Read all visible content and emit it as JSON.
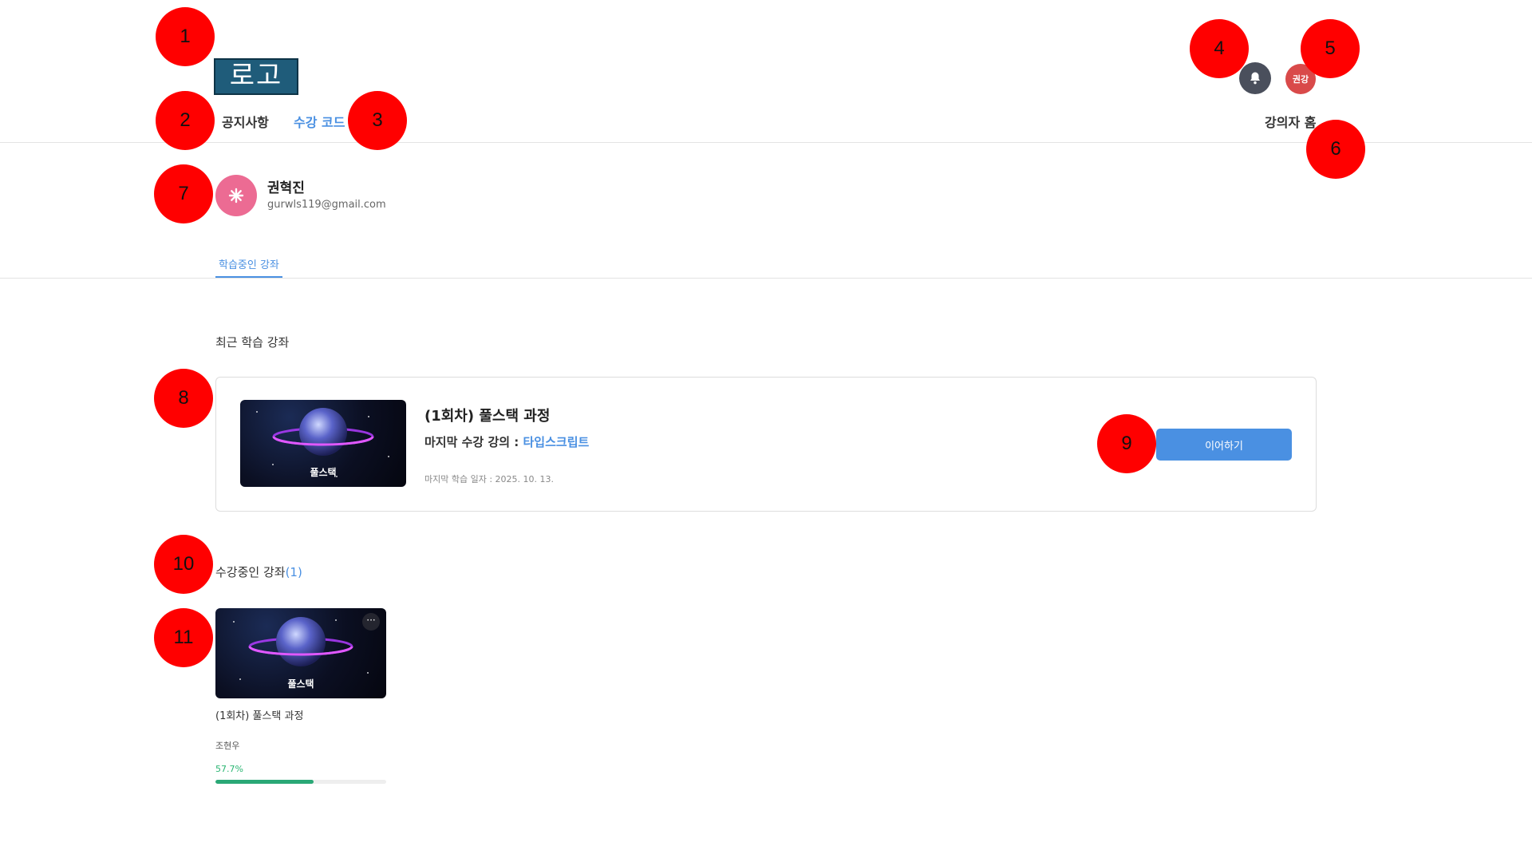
{
  "header": {
    "logo_text": "로고",
    "nav": [
      {
        "label": "공지사항",
        "active": false
      },
      {
        "label": "수강 코드",
        "active": true
      }
    ],
    "bell_icon": "bell-icon",
    "user_avatar_text": "권강",
    "lecturer_home_label": "강의자 홈"
  },
  "profile": {
    "avatar_icon": "asterisk-icon",
    "name": "권혁진",
    "email": "gurwls119@gmail.com"
  },
  "tabs": [
    {
      "label": "학습중인 강좌",
      "active": true
    }
  ],
  "recent": {
    "section_title": "최근 학습 강좌",
    "course_title": "(1회차) 풀스택 과정",
    "thumbnail_label": "풀스택",
    "last_lecture_prefix": "마지막 수강 강의 : ",
    "last_lecture_name": "타입스크립트",
    "last_date": "마지막 학습 일자 : 2025. 10. 13.",
    "continue_label": "이어하기"
  },
  "enrolled": {
    "section_title": "수강중인 강좌",
    "count": "(1)",
    "courses": [
      {
        "thumbnail_label": "풀스택",
        "title": "(1회차) 풀스택 과정",
        "instructor": "조현우",
        "progress_text": "57.7%",
        "progress": 0.577,
        "more_label": "···"
      }
    ]
  },
  "markers": [
    "1",
    "2",
    "3",
    "4",
    "5",
    "6",
    "7",
    "8",
    "9",
    "10",
    "11"
  ],
  "colors": {
    "accent": "#4a90e2",
    "progress": "#2aa876",
    "marker": "#ff0000",
    "logo_bg": "#1f5c7a"
  }
}
